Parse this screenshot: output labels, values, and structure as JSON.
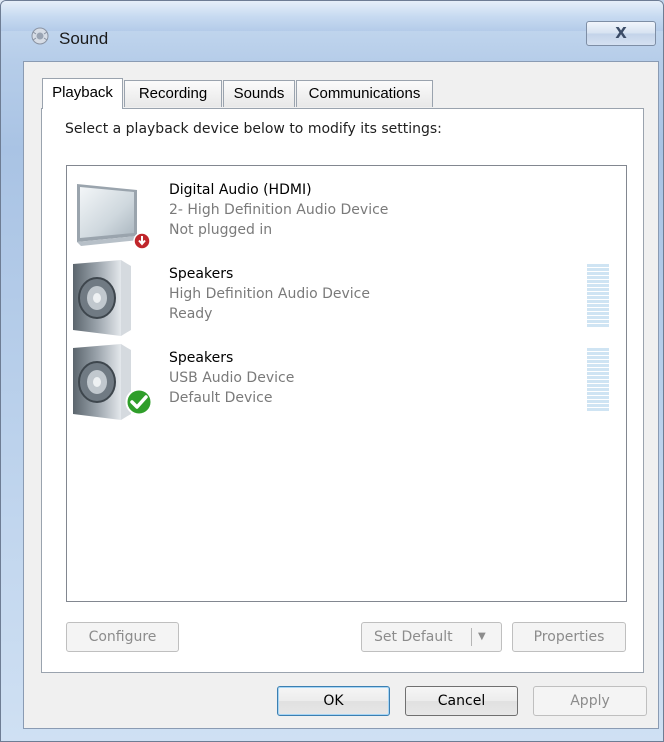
{
  "window": {
    "title": "Sound",
    "close_label": "X"
  },
  "tabs": [
    {
      "label": "Playback",
      "active": true
    },
    {
      "label": "Recording",
      "active": false
    },
    {
      "label": "Sounds",
      "active": false
    },
    {
      "label": "Communications",
      "active": false
    }
  ],
  "playback": {
    "instruction": "Select a playback device below to modify its settings:",
    "devices": [
      {
        "name": "Digital Audio (HDMI)",
        "description": "2- High Definition Audio Device",
        "status": "Not plugged in",
        "icon": "monitor-icon",
        "badge": "unplugged-badge-icon"
      },
      {
        "name": "Speakers",
        "description": "High Definition Audio Device",
        "status": "Ready",
        "icon": "speaker-icon",
        "badge": null
      },
      {
        "name": "Speakers",
        "description": "USB Audio Device",
        "status": "Default Device",
        "icon": "speaker-icon",
        "badge": "default-checkmark-icon"
      }
    ],
    "buttons": {
      "configure": "Configure",
      "set_default": "Set Default",
      "properties": "Properties"
    }
  },
  "footer": {
    "ok": "OK",
    "cancel": "Cancel",
    "apply": "Apply"
  },
  "colors": {
    "badge_red": "#c0262b",
    "badge_green": "#2f9e2a",
    "meter": "#cfe4f3"
  }
}
